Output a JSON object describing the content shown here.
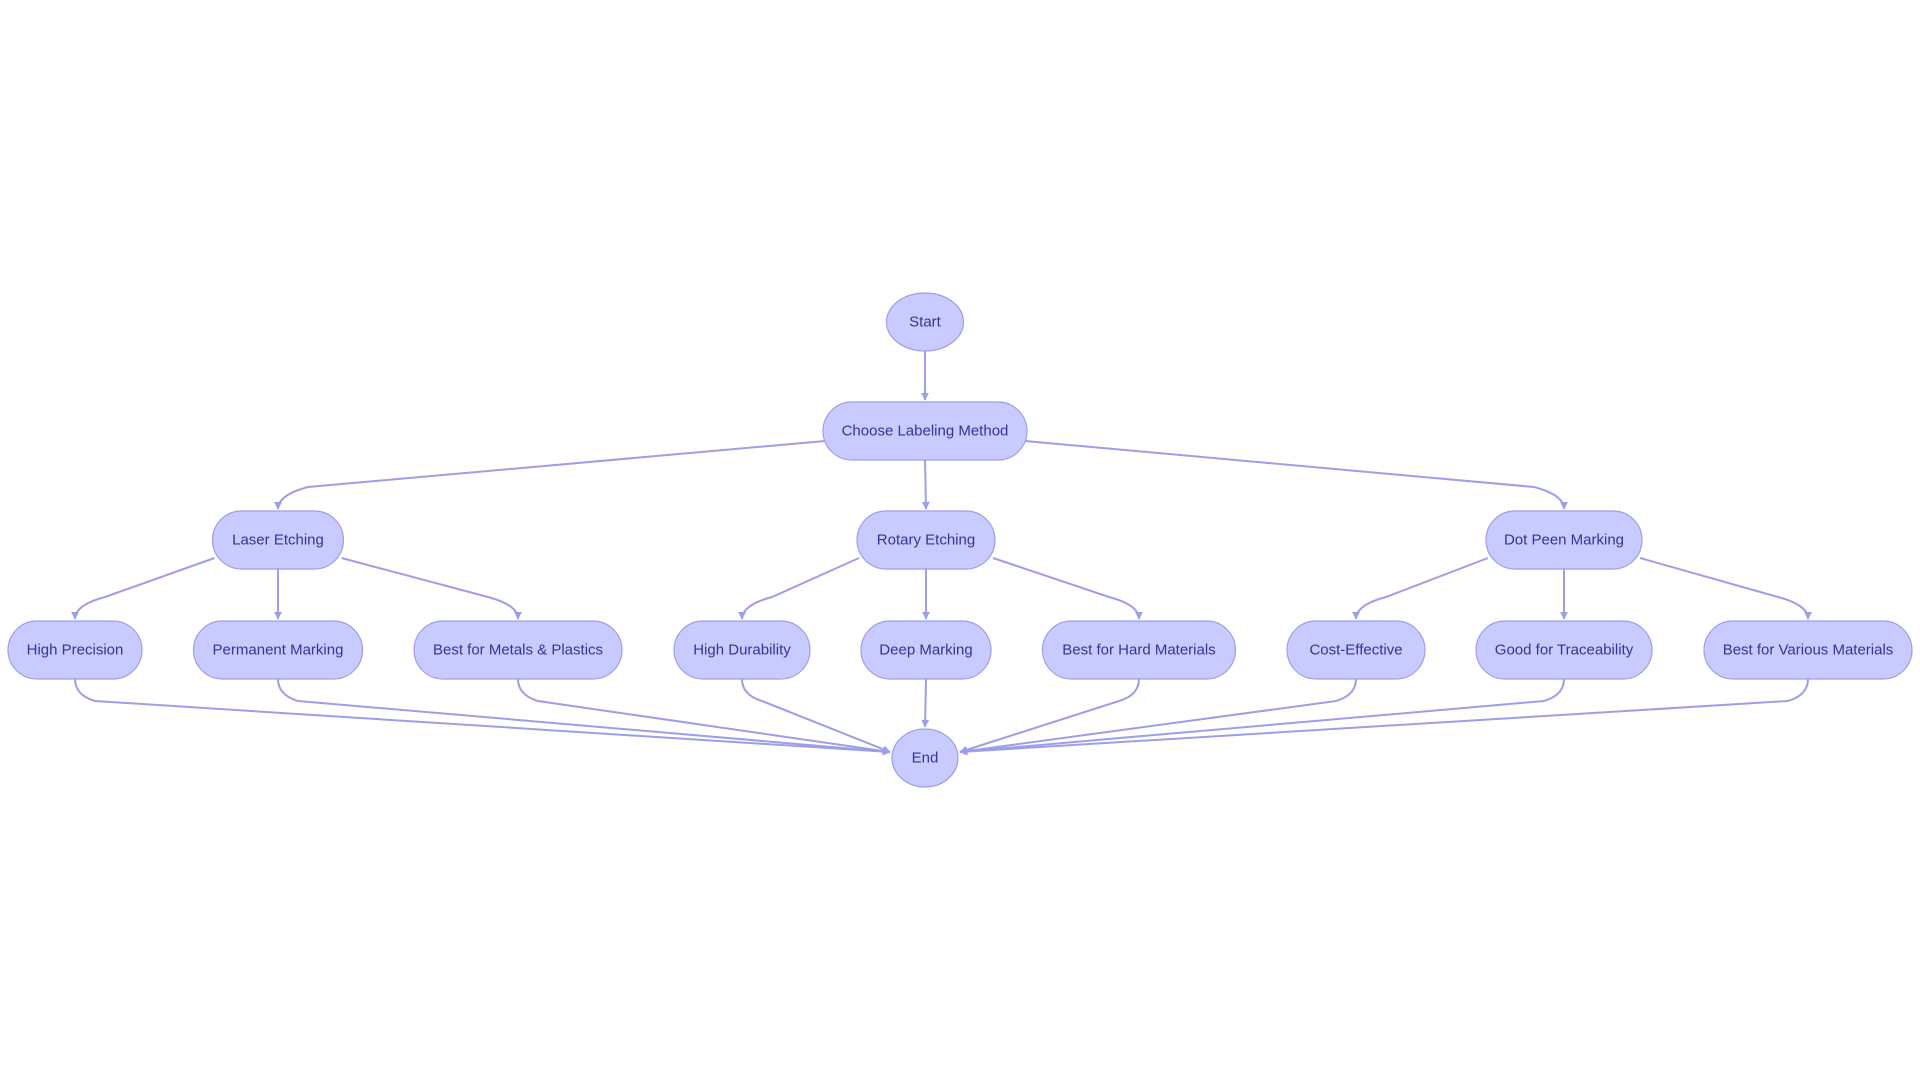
{
  "diagram": {
    "type": "flowchart",
    "direction": "top-down",
    "colors": {
      "node_fill": "#c9caff",
      "node_stroke": "#9c9fe8",
      "edge": "#9c9fe8",
      "text": "#34349a",
      "background": "#ffffff"
    },
    "nodes": [
      {
        "id": "start",
        "label": "Start",
        "shape": "circle"
      },
      {
        "id": "choose",
        "label": "Choose Labeling Method",
        "shape": "stadium"
      },
      {
        "id": "laser",
        "label": "Laser Etching",
        "shape": "stadium"
      },
      {
        "id": "rotary",
        "label": "Rotary Etching",
        "shape": "stadium"
      },
      {
        "id": "dotpeen",
        "label": "Dot Peen Marking",
        "shape": "stadium"
      },
      {
        "id": "highprecision",
        "label": "High Precision",
        "shape": "stadium"
      },
      {
        "id": "permanent",
        "label": "Permanent Marking",
        "shape": "stadium"
      },
      {
        "id": "metalsplastics",
        "label": "Best for Metals & Plastics",
        "shape": "stadium"
      },
      {
        "id": "highdurability",
        "label": "High Durability",
        "shape": "stadium"
      },
      {
        "id": "deepmarking",
        "label": "Deep Marking",
        "shape": "stadium"
      },
      {
        "id": "hardmaterials",
        "label": "Best for Hard Materials",
        "shape": "stadium"
      },
      {
        "id": "costeffective",
        "label": "Cost-Effective",
        "shape": "stadium"
      },
      {
        "id": "traceability",
        "label": "Good for Traceability",
        "shape": "stadium"
      },
      {
        "id": "variousmaterials",
        "label": "Best for Various Materials",
        "shape": "stadium"
      },
      {
        "id": "end",
        "label": "End",
        "shape": "circle"
      }
    ],
    "edges": [
      {
        "from": "start",
        "to": "choose"
      },
      {
        "from": "choose",
        "to": "laser"
      },
      {
        "from": "choose",
        "to": "rotary"
      },
      {
        "from": "choose",
        "to": "dotpeen"
      },
      {
        "from": "laser",
        "to": "highprecision"
      },
      {
        "from": "laser",
        "to": "permanent"
      },
      {
        "from": "laser",
        "to": "metalsplastics"
      },
      {
        "from": "rotary",
        "to": "highdurability"
      },
      {
        "from": "rotary",
        "to": "deepmarking"
      },
      {
        "from": "rotary",
        "to": "hardmaterials"
      },
      {
        "from": "dotpeen",
        "to": "costeffective"
      },
      {
        "from": "dotpeen",
        "to": "traceability"
      },
      {
        "from": "dotpeen",
        "to": "variousmaterials"
      },
      {
        "from": "highprecision",
        "to": "end"
      },
      {
        "from": "permanent",
        "to": "end"
      },
      {
        "from": "metalsplastics",
        "to": "end"
      },
      {
        "from": "highdurability",
        "to": "end"
      },
      {
        "from": "deepmarking",
        "to": "end"
      },
      {
        "from": "hardmaterials",
        "to": "end"
      },
      {
        "from": "costeffective",
        "to": "end"
      },
      {
        "from": "traceability",
        "to": "end"
      },
      {
        "from": "variousmaterials",
        "to": "end"
      }
    ]
  }
}
